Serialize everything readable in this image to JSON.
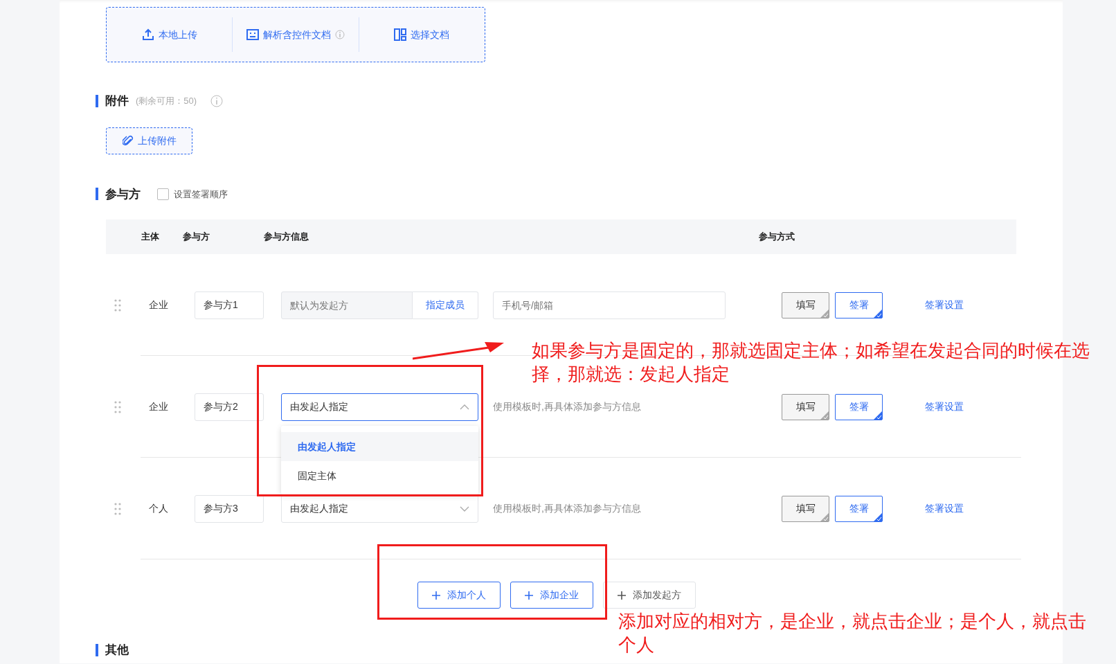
{
  "upload_options": [
    {
      "label": "本地上传",
      "kind": "upload",
      "info": false
    },
    {
      "label": "解析含控件文档",
      "kind": "parse",
      "info": true
    },
    {
      "label": "选择文档",
      "kind": "select",
      "info": false
    }
  ],
  "attachments": {
    "title": "附件",
    "remaining": "(剩余可用：50)",
    "upload_button": "上传附件"
  },
  "participants": {
    "title": "参与方",
    "order_checkbox": {
      "label": "设置签署顺序",
      "checked": false
    },
    "columns": [
      "主体",
      "参与方",
      "参与方信息",
      "参与方式"
    ],
    "rows": [
      {
        "subject": "企业",
        "name": "参与方1",
        "info": {
          "kind": "member",
          "placeholder": "默认为发起方",
          "button": "指定成员",
          "contact_placeholder": "手机号/邮箱"
        },
        "modes": [
          {
            "label": "填写",
            "selected": false
          },
          {
            "label": "签署",
            "selected": true
          }
        ],
        "settings_link": "签署设置"
      },
      {
        "subject": "企业",
        "name": "参与方2",
        "info": {
          "kind": "select",
          "value": "由发起人指定",
          "expanded": true,
          "hint": "使用模板时,再具体添加参与方信息",
          "options": [
            {
              "label": "由发起人指定",
              "selected": true
            },
            {
              "label": "固定主体",
              "selected": false
            }
          ]
        },
        "modes": [
          {
            "label": "填写",
            "selected": false
          },
          {
            "label": "签署",
            "selected": true
          }
        ],
        "settings_link": "签署设置"
      },
      {
        "subject": "个人",
        "name": "参与方3",
        "info": {
          "kind": "select",
          "value": "由发起人指定",
          "expanded": false,
          "hint": "使用模板时,再具体添加参与方信息"
        },
        "modes": [
          {
            "label": "填写",
            "selected": false
          },
          {
            "label": "签署",
            "selected": true
          }
        ],
        "settings_link": "签署设置"
      }
    ],
    "add_buttons": [
      {
        "label": "添加个人",
        "kind": "primary"
      },
      {
        "label": "添加企业",
        "kind": "primary"
      },
      {
        "label": "添加发起方",
        "kind": "default"
      }
    ]
  },
  "other": {
    "title": "其他"
  },
  "annotations": [
    {
      "text": "如果参与方是固定的，那就选固定主体；如希望在发起合同的时候在选择，那就选：发起人指定"
    },
    {
      "text": "添加对应的相对方，是企业，就点击企业；是个人，就点击个人"
    }
  ]
}
